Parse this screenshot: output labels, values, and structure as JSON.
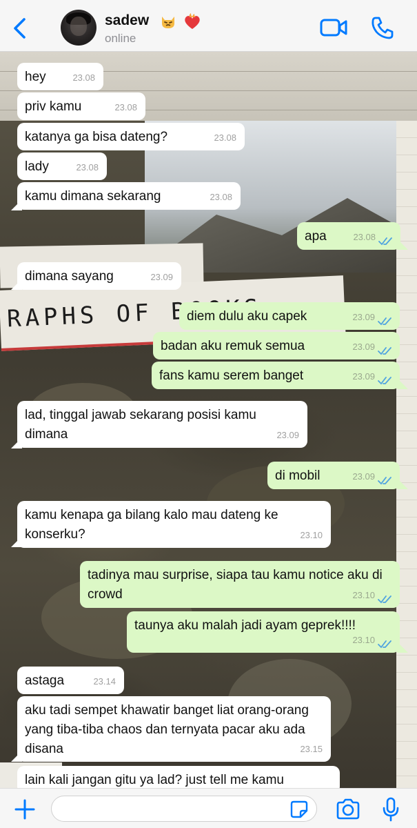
{
  "header": {
    "contact_name": "sadew",
    "status": "online",
    "emojis": [
      "pouting-cat-emoji",
      "heart-on-fire-emoji"
    ],
    "icons": [
      "back-chevron-icon",
      "video-camera-icon",
      "phone-icon"
    ]
  },
  "background_scrawl": "RAPHS OF BOOKS",
  "messages": [
    {
      "dir": "in",
      "text": "hey",
      "time": "23.08"
    },
    {
      "dir": "in",
      "text": "priv kamu",
      "time": "23.08"
    },
    {
      "dir": "in",
      "text": "katanya ga bisa dateng?",
      "time": "23.08"
    },
    {
      "dir": "in",
      "text": "lady",
      "time": "23.08"
    },
    {
      "dir": "in",
      "text": "kamu dimana sekarang",
      "time": "23.08"
    },
    {
      "dir": "out",
      "text": "apa",
      "time": "23.08"
    },
    {
      "dir": "in",
      "text": "dimana sayang",
      "time": "23.09"
    },
    {
      "dir": "out",
      "text": "diem dulu aku capek",
      "time": "23.09"
    },
    {
      "dir": "out",
      "text": "badan aku remuk semua",
      "time": "23.09"
    },
    {
      "dir": "out",
      "text": "fans kamu serem banget",
      "time": "23.09"
    },
    {
      "dir": "in",
      "text": "lad, tinggal jawab sekarang posisi kamu dimana",
      "time": "23.09"
    },
    {
      "dir": "out",
      "text": "di mobil",
      "time": "23.09"
    },
    {
      "dir": "in",
      "text": "kamu kenapa ga bilang kalo mau dateng ke konserku?",
      "time": "23.10"
    },
    {
      "dir": "out",
      "text": "tadinya mau surprise, siapa tau kamu notice aku di crowd",
      "time": "23.10"
    },
    {
      "dir": "out",
      "text": "taunya aku malah jadi ayam geprek!!!!",
      "time": "23.10"
    },
    {
      "dir": "in",
      "text": "astaga",
      "time": "23.14"
    },
    {
      "dir": "in",
      "text": "aku tadi sempet khawatir banget liat orang-orang yang tiba-tiba chaos dan ternyata pacar aku ada disana",
      "time": "23.15"
    },
    {
      "dir": "in",
      "text": "lain kali jangan gitu ya lad? just tell me kamu",
      "time": ""
    }
  ],
  "composer": {
    "placeholder": "",
    "icons": [
      "plus-icon",
      "sticker-icon",
      "camera-icon",
      "microphone-icon"
    ]
  },
  "colors": {
    "accent": "#007aff",
    "outgoing_bubble": "#dcf8c6",
    "incoming_bubble": "#ffffff",
    "read_ticks": "#4fa3e0"
  }
}
